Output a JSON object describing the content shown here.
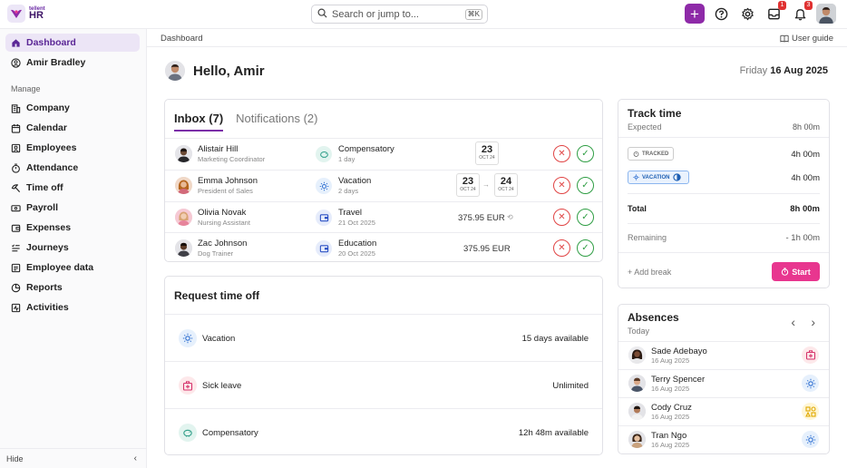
{
  "app": {
    "logo_small": "tellent",
    "logo_big": "HR",
    "plus_icon": "plus-icon"
  },
  "search": {
    "placeholder": "Search or jump to...",
    "shortcut": "⌘K"
  },
  "topbar": {
    "inbox_badge": "1",
    "notifications_badge": "3"
  },
  "sidebar": {
    "items": [
      {
        "label": "Dashboard",
        "icon": "home-icon"
      },
      {
        "label": "Amir Bradley",
        "icon": "user-circle-icon"
      }
    ],
    "manage_label": "Manage",
    "manage_items": [
      {
        "label": "Company",
        "icon": "building-icon"
      },
      {
        "label": "Calendar",
        "icon": "calendar-icon"
      },
      {
        "label": "Employees",
        "icon": "employees-icon"
      },
      {
        "label": "Attendance",
        "icon": "stopwatch-icon"
      },
      {
        "label": "Time off",
        "icon": "beach-icon"
      },
      {
        "label": "Payroll",
        "icon": "banknote-icon"
      },
      {
        "label": "Expenses",
        "icon": "wallet-icon"
      },
      {
        "label": "Journeys",
        "icon": "list-icon"
      },
      {
        "label": "Employee data",
        "icon": "data-icon"
      },
      {
        "label": "Reports",
        "icon": "pie-chart-icon"
      },
      {
        "label": "Activities",
        "icon": "activity-icon"
      }
    ],
    "hide_label": "Hide"
  },
  "breadcrumb": {
    "current": "Dashboard",
    "user_guide": "User guide"
  },
  "greeting": {
    "text": "Hello, Amir",
    "weekday": "Friday",
    "date": "16 Aug 2025"
  },
  "inbox": {
    "tabs": [
      {
        "label": "Inbox (7)"
      },
      {
        "label": "Notifications (2)"
      }
    ],
    "rows": [
      {
        "name": "Alistair Hill",
        "role": "Marketing Coordinator",
        "category": "Compensatory",
        "detail": "1 day",
        "icon": "piggy-bank-icon",
        "date_from_day": "23",
        "date_from_month": "OCT 24"
      },
      {
        "name": "Emma Johnson",
        "role": "President of Sales",
        "category": "Vacation",
        "detail": "2 days",
        "icon": "sun-icon",
        "date_from_day": "23",
        "date_from_month": "OCT 24",
        "date_to_day": "24",
        "date_to_month": "OCT 24"
      },
      {
        "name": "Olivia Novak",
        "role": "Nursing Assistant",
        "category": "Travel",
        "detail": "21 Oct 2025",
        "icon": "wallet-icon",
        "amount": "375.95 EUR"
      },
      {
        "name": "Zac Johnson",
        "role": "Dog Trainer",
        "category": "Education",
        "detail": "20 Oct 2025",
        "icon": "wallet-icon",
        "amount": "375.95 EUR"
      }
    ]
  },
  "request_time_off": {
    "title": "Request time off",
    "rows": [
      {
        "label": "Vacation",
        "value": "15 days available",
        "icon": "sun-icon"
      },
      {
        "label": "Sick leave",
        "value": "Unlimited",
        "icon": "medical-kit-icon"
      },
      {
        "label": "Compensatory",
        "value": "12h 48m available",
        "icon": "piggy-bank-icon"
      }
    ]
  },
  "track_time": {
    "title": "Track time",
    "expected_label": "Expected",
    "expected_value": "8h 00m",
    "tracked_label": "TRACKED",
    "tracked_value": "4h 00m",
    "vacation_label": "VACATION",
    "vacation_value": "4h 00m",
    "total_label": "Total",
    "total_value": "8h 00m",
    "remaining_label": "Remaining",
    "remaining_value": "- 1h 00m",
    "add_break": "+ Add break",
    "start": "Start"
  },
  "absences": {
    "title": "Absences",
    "subtitle": "Today",
    "rows": [
      {
        "name": "Sade Adebayo",
        "date": "16 Aug 2025",
        "icon": "medical-kit-icon"
      },
      {
        "name": "Terry Spencer",
        "date": "16 Aug 2025",
        "icon": "sun-icon"
      },
      {
        "name": "Cody Cruz",
        "date": "16 Aug 2025",
        "icon": "shapes-icon"
      },
      {
        "name": "Tran Ngo",
        "date": "16 Aug 2025",
        "icon": "sun-icon"
      }
    ]
  },
  "colors": {
    "accent": "#8e2aa8",
    "start_button": "#e8368f",
    "reject": "#e04444",
    "approve": "#2f9e44"
  }
}
